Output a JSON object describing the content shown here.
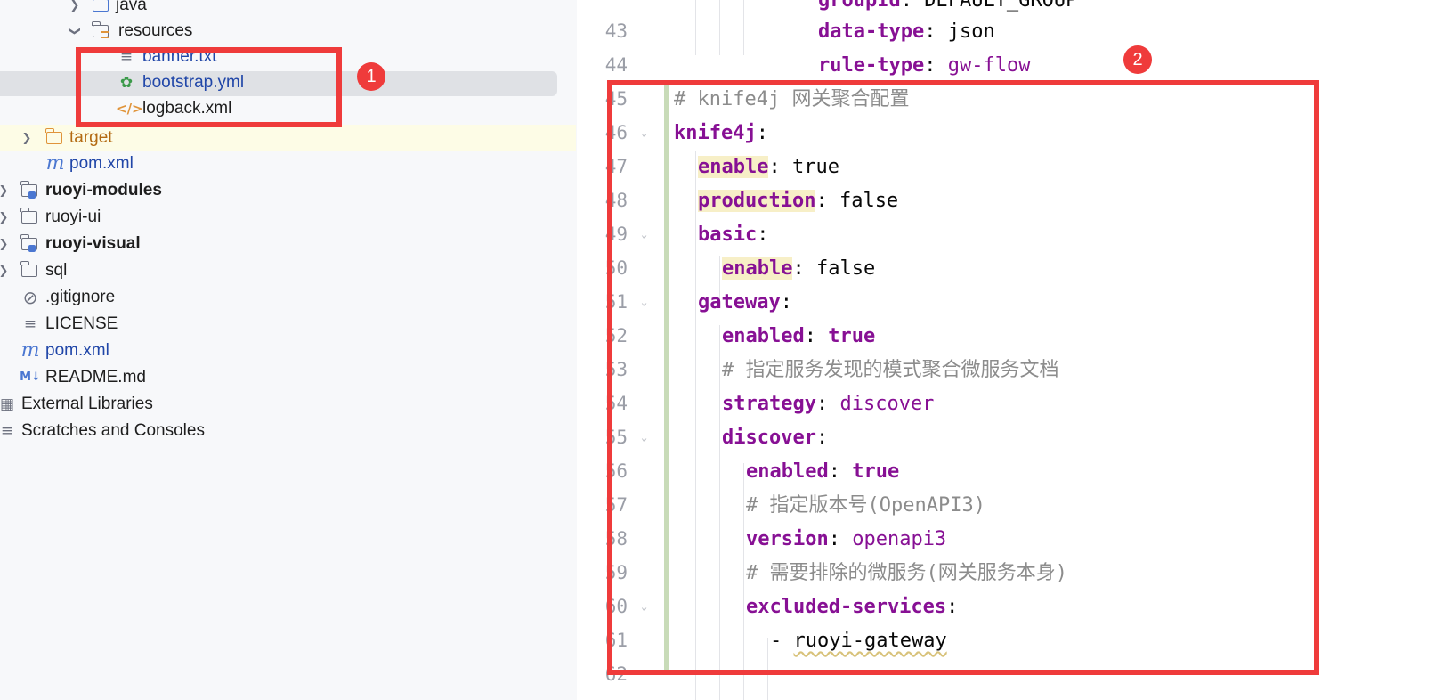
{
  "project_tree": {
    "items": [
      {
        "label": "java",
        "icon": "folder-icon"
      },
      {
        "label": "resources",
        "icon": "resources-folder-icon"
      },
      {
        "label": "banner.txt",
        "icon": "text-file-icon"
      },
      {
        "label": "bootstrap.yml",
        "icon": "spring-config-icon"
      },
      {
        "label": "logback.xml",
        "icon": "xml-file-icon"
      },
      {
        "label": "target",
        "icon": "excluded-folder-icon"
      },
      {
        "label": "pom.xml",
        "icon": "maven-icon"
      },
      {
        "label": "ruoyi-modules",
        "icon": "module-folder-icon"
      },
      {
        "label": "ruoyi-ui",
        "icon": "folder-icon"
      },
      {
        "label": "ruoyi-visual",
        "icon": "module-folder-icon"
      },
      {
        "label": "sql",
        "icon": "folder-icon"
      },
      {
        "label": ".gitignore",
        "icon": "ignore-file-icon"
      },
      {
        "label": "LICENSE",
        "icon": "text-lines-icon"
      },
      {
        "label": "pom.xml",
        "icon": "maven-icon"
      },
      {
        "label": "README.md",
        "icon": "markdown-icon"
      },
      {
        "label": "External Libraries",
        "icon": "libraries-icon"
      },
      {
        "label": "Scratches and Consoles",
        "icon": "scratches-icon"
      }
    ]
  },
  "editor": {
    "top_partial": {
      "key": "groupId",
      "value": "DEFAULT_GROUP"
    },
    "lines": [
      {
        "num": "43",
        "key": "data-type",
        "sep": ": ",
        "value": "json"
      },
      {
        "num": "44",
        "key": "rule-type",
        "sep": ": ",
        "value": "gw-flow"
      },
      {
        "num": "45",
        "comment": "# knife4j 网关聚合配置"
      },
      {
        "num": "46",
        "key": "knife4j",
        "sep": ":"
      },
      {
        "num": "47",
        "key": "enable",
        "sep": ": ",
        "value": "true"
      },
      {
        "num": "48",
        "key": "production",
        "sep": ": ",
        "value": "false"
      },
      {
        "num": "49",
        "key": "basic",
        "sep": ":"
      },
      {
        "num": "50",
        "key": "enable",
        "sep": ": ",
        "value": "false"
      },
      {
        "num": "51",
        "key": "gateway",
        "sep": ":"
      },
      {
        "num": "52",
        "key": "enabled",
        "sep": ": ",
        "value": "true"
      },
      {
        "num": "53",
        "comment": "# 指定服务发现的模式聚合微服务文档"
      },
      {
        "num": "54",
        "key": "strategy",
        "sep": ": ",
        "value": "discover"
      },
      {
        "num": "55",
        "key": "discover",
        "sep": ":"
      },
      {
        "num": "56",
        "key": "enabled",
        "sep": ": ",
        "value": "true"
      },
      {
        "num": "57",
        "comment": "# 指定版本号(OpenAPI3)"
      },
      {
        "num": "58",
        "key": "version",
        "sep": ": ",
        "value": "openapi3"
      },
      {
        "num": "59",
        "comment": "# 需要排除的微服务(网关服务本身)"
      },
      {
        "num": "60",
        "key": "excluded-services",
        "sep": ":"
      },
      {
        "num": "61",
        "dash": "- ",
        "value": "ruoyi-gateway"
      },
      {
        "num": "62"
      }
    ]
  },
  "annotations": {
    "badge_1": "1",
    "badge_2": "2",
    "color": "#ef3b3b"
  }
}
